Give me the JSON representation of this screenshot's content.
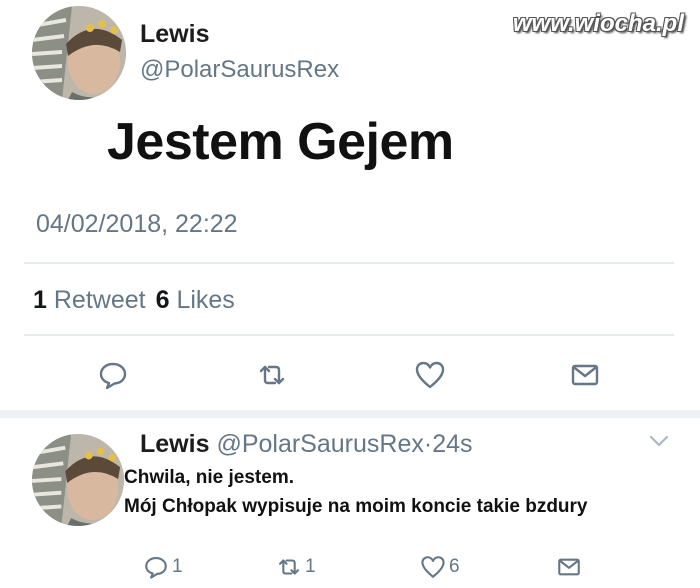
{
  "watermark": "www.wiocha.pl",
  "tweet": {
    "author_name": "Lewis",
    "author_handle": "@PolarSaurusRex",
    "text": "Jestem Gejem",
    "timestamp": "04/02/2018, 22:22",
    "retweet_count": "1",
    "retweet_label": "Retweet",
    "like_count": "6",
    "like_label": "Likes",
    "actions": [
      "reply-icon",
      "retweet-icon",
      "like-icon",
      "share-icon"
    ]
  },
  "reply": {
    "author_name": "Lewis",
    "author_handle": "@PolarSaurusRex",
    "separator": "·",
    "age": "24s",
    "lines": [
      "Chwila, nie jestem.",
      "Mój Chłopak wypisuje na moim koncie takie bzdury"
    ],
    "reply_count": "1",
    "retweet_count": "1",
    "like_count": "6"
  },
  "colors": {
    "muted": "#657786",
    "divider": "#e6ecf0",
    "text": "#14171a"
  }
}
